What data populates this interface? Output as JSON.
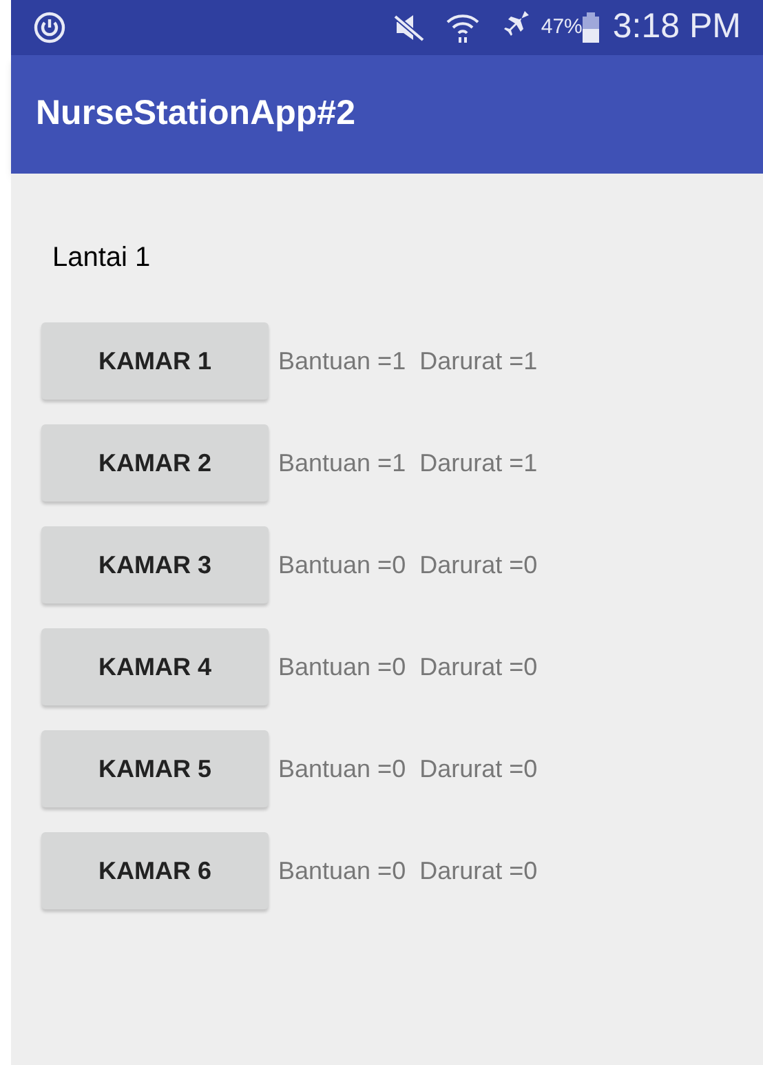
{
  "status_bar": {
    "battery": "47%",
    "time": "3:18 PM"
  },
  "app_bar": {
    "title": "NurseStationApp#2"
  },
  "floor": {
    "label": "Lantai 1"
  },
  "rooms": [
    {
      "button": "KAMAR 1",
      "help": "Bantuan =1",
      "emergency": "Darurat =1"
    },
    {
      "button": "KAMAR 2",
      "help": "Bantuan =1",
      "emergency": "Darurat =1"
    },
    {
      "button": "KAMAR 3",
      "help": "Bantuan =0",
      "emergency": "Darurat =0"
    },
    {
      "button": "KAMAR 4",
      "help": "Bantuan =0",
      "emergency": "Darurat =0"
    },
    {
      "button": "KAMAR 5",
      "help": "Bantuan =0",
      "emergency": "Darurat =0"
    },
    {
      "button": "KAMAR 6",
      "help": "Bantuan =0",
      "emergency": "Darurat =0"
    }
  ]
}
